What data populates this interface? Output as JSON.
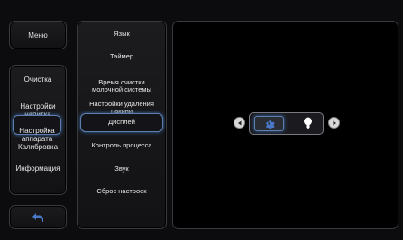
{
  "menu_button": {
    "label": "Меню"
  },
  "left_nav": {
    "items": [
      {
        "label": "Очистка"
      },
      {
        "label": "Настройки\nнапитка"
      },
      {
        "label": "Настройка\nаппарата"
      },
      {
        "label": "Калибровка"
      },
      {
        "label": "Информация"
      }
    ],
    "active_index": 2
  },
  "back_button": {
    "icon": "back-arrow-icon"
  },
  "settings_list": {
    "items": [
      {
        "label": "Язык"
      },
      {
        "label": "Таймер"
      },
      {
        "label": "Время очистки\nмолочной системы"
      },
      {
        "label": "Настройки удаления\nнакипи"
      },
      {
        "label": "Дисплей"
      },
      {
        "label": "Контроль процесса"
      },
      {
        "label": "Звук"
      },
      {
        "label": "Сброс настроек"
      }
    ],
    "active_index": 4
  },
  "display_setting": {
    "options": [
      {
        "icon": "gear-icon",
        "selected": true
      },
      {
        "icon": "lightbulb-icon",
        "selected": false
      }
    ],
    "prev_icon": "arrow-left-icon",
    "next_icon": "arrow-right-icon"
  },
  "colors": {
    "accent": "#5c7fb0",
    "selected_glow": "#3b6aa8",
    "icon_blue": "#4a78c8"
  }
}
